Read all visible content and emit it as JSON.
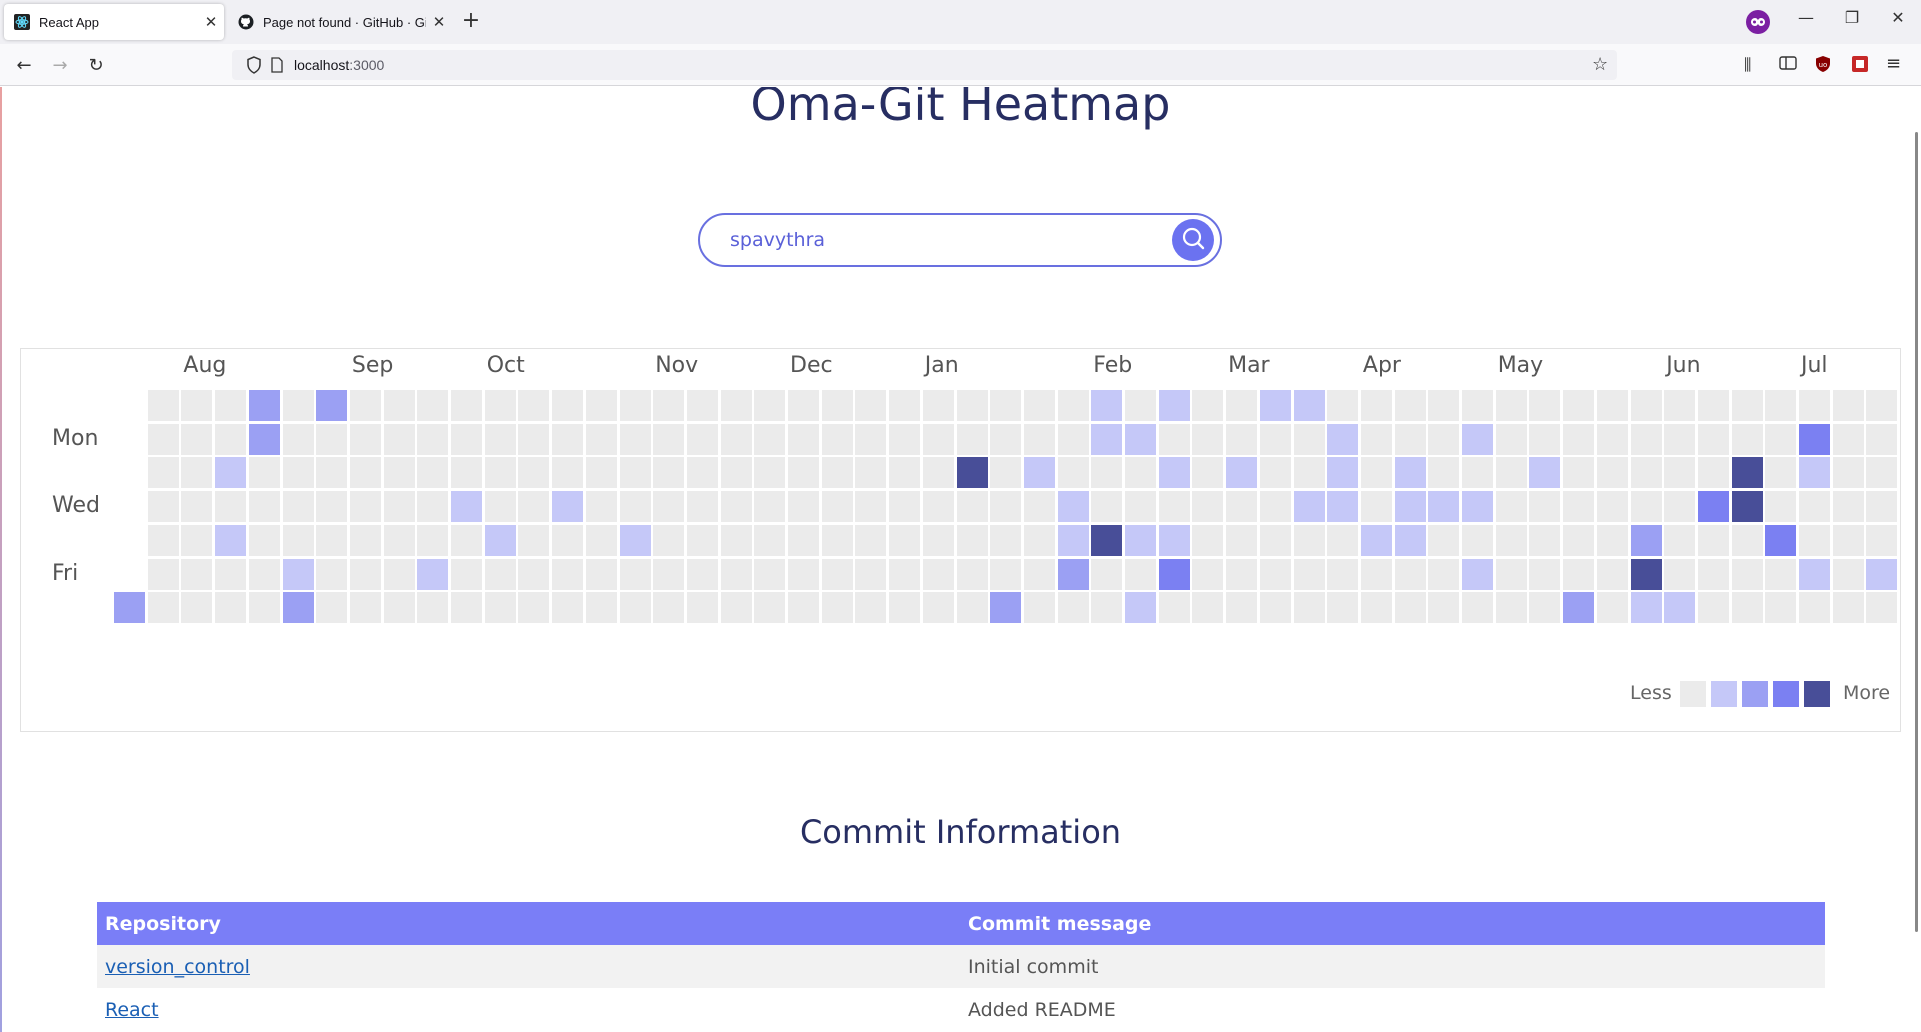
{
  "browser": {
    "tabs": [
      {
        "title": "React App",
        "active": true
      },
      {
        "title": "Page not found · GitHub · GitHub",
        "active": false
      }
    ],
    "url": {
      "host": "localhost",
      "port": ":3000"
    }
  },
  "app": {
    "title": "Oma-Git Heatmap",
    "search_value": "spavythra",
    "search_placeholder": ""
  },
  "heatmap": {
    "months": [
      "Aug",
      "Sep",
      "Oct",
      "Nov",
      "Dec",
      "Jan",
      "Feb",
      "Mar",
      "Apr",
      "May",
      "Jun",
      "Jul"
    ],
    "month_weeks": [
      2,
      7,
      11,
      16,
      20,
      24,
      29,
      33,
      37,
      41,
      46,
      50
    ],
    "day_labels": [
      {
        "label": "Mon",
        "row": 1
      },
      {
        "label": "Wed",
        "row": 3
      },
      {
        "label": "Fri",
        "row": 5
      }
    ],
    "legend_less": "Less",
    "legend_more": "More",
    "colors": [
      "#ebebeb",
      "#c5c8f8",
      "#9ba0f3",
      "#7b80f2",
      "#484e98"
    ],
    "weeks": 53,
    "active": [
      {
        "w": 0,
        "d": 6,
        "l": 2
      },
      {
        "w": 3,
        "d": 2,
        "l": 1
      },
      {
        "w": 3,
        "d": 4,
        "l": 1
      },
      {
        "w": 4,
        "d": 0,
        "l": 2
      },
      {
        "w": 4,
        "d": 1,
        "l": 2
      },
      {
        "w": 5,
        "d": 5,
        "l": 1
      },
      {
        "w": 5,
        "d": 6,
        "l": 2
      },
      {
        "w": 6,
        "d": 0,
        "l": 2
      },
      {
        "w": 9,
        "d": 5,
        "l": 1
      },
      {
        "w": 10,
        "d": 3,
        "l": 1
      },
      {
        "w": 11,
        "d": 4,
        "l": 1
      },
      {
        "w": 13,
        "d": 3,
        "l": 1
      },
      {
        "w": 15,
        "d": 4,
        "l": 1
      },
      {
        "w": 25,
        "d": 2,
        "l": 4
      },
      {
        "w": 26,
        "d": 6,
        "l": 2
      },
      {
        "w": 27,
        "d": 2,
        "l": 1
      },
      {
        "w": 28,
        "d": 3,
        "l": 1
      },
      {
        "w": 28,
        "d": 4,
        "l": 1
      },
      {
        "w": 28,
        "d": 5,
        "l": 2
      },
      {
        "w": 29,
        "d": 0,
        "l": 1
      },
      {
        "w": 29,
        "d": 1,
        "l": 1
      },
      {
        "w": 29,
        "d": 4,
        "l": 4
      },
      {
        "w": 30,
        "d": 1,
        "l": 1
      },
      {
        "w": 30,
        "d": 4,
        "l": 1
      },
      {
        "w": 30,
        "d": 6,
        "l": 1
      },
      {
        "w": 31,
        "d": 0,
        "l": 1
      },
      {
        "w": 31,
        "d": 2,
        "l": 1
      },
      {
        "w": 31,
        "d": 4,
        "l": 1
      },
      {
        "w": 31,
        "d": 5,
        "l": 3
      },
      {
        "w": 33,
        "d": 2,
        "l": 1
      },
      {
        "w": 34,
        "d": 0,
        "l": 1
      },
      {
        "w": 35,
        "d": 0,
        "l": 1
      },
      {
        "w": 35,
        "d": 3,
        "l": 1
      },
      {
        "w": 36,
        "d": 1,
        "l": 1
      },
      {
        "w": 36,
        "d": 2,
        "l": 1
      },
      {
        "w": 36,
        "d": 3,
        "l": 1
      },
      {
        "w": 37,
        "d": 4,
        "l": 1
      },
      {
        "w": 38,
        "d": 2,
        "l": 1
      },
      {
        "w": 38,
        "d": 3,
        "l": 1
      },
      {
        "w": 38,
        "d": 4,
        "l": 1
      },
      {
        "w": 39,
        "d": 3,
        "l": 1
      },
      {
        "w": 40,
        "d": 1,
        "l": 1
      },
      {
        "w": 40,
        "d": 3,
        "l": 1
      },
      {
        "w": 40,
        "d": 5,
        "l": 1
      },
      {
        "w": 42,
        "d": 2,
        "l": 1
      },
      {
        "w": 43,
        "d": 6,
        "l": 2
      },
      {
        "w": 45,
        "d": 4,
        "l": 2
      },
      {
        "w": 45,
        "d": 5,
        "l": 4
      },
      {
        "w": 45,
        "d": 6,
        "l": 1
      },
      {
        "w": 46,
        "d": 6,
        "l": 1
      },
      {
        "w": 47,
        "d": 3,
        "l": 3
      },
      {
        "w": 48,
        "d": 2,
        "l": 4
      },
      {
        "w": 48,
        "d": 3,
        "l": 4
      },
      {
        "w": 49,
        "d": 4,
        "l": 3
      },
      {
        "w": 50,
        "d": 1,
        "l": 3
      },
      {
        "w": 50,
        "d": 2,
        "l": 1
      },
      {
        "w": 50,
        "d": 5,
        "l": 1
      },
      {
        "w": 52,
        "d": 5,
        "l": 1
      }
    ]
  },
  "commits": {
    "heading": "Commit Information",
    "headers": [
      "Repository",
      "Commit message"
    ],
    "rows": [
      {
        "repo": "version_control",
        "message": "Initial commit"
      },
      {
        "repo": "React",
        "message": "Added README"
      }
    ]
  }
}
